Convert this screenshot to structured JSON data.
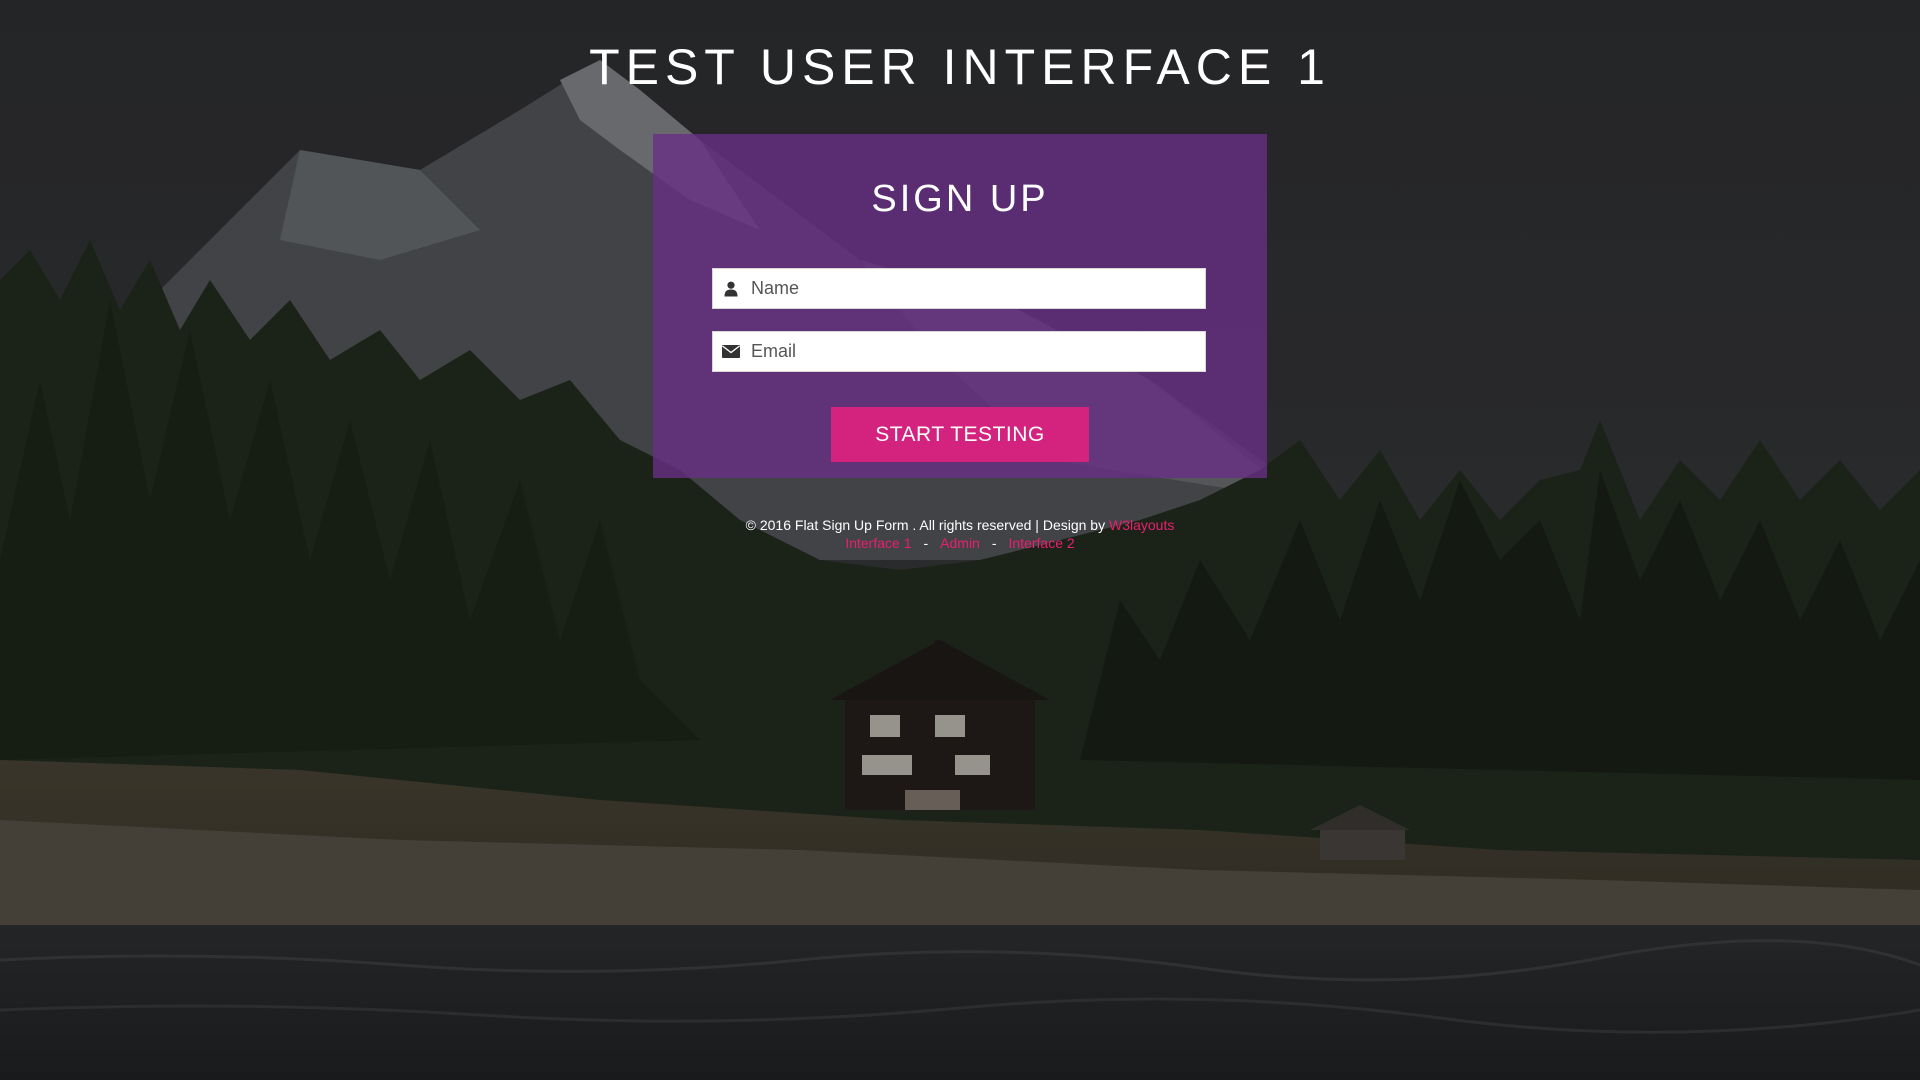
{
  "page": {
    "title": "TEST USER INTERFACE 1"
  },
  "form": {
    "heading": "SIGN UP",
    "name_field": {
      "placeholder": "Name",
      "value": "",
      "icon": "user-icon"
    },
    "email_field": {
      "placeholder": "Email",
      "value": "",
      "icon": "envelope-icon"
    },
    "submit_label": "START TESTING"
  },
  "footer": {
    "copyright": "© 2016 Flat Sign Up Form . All rights reserved | Design by",
    "designer_link": "W3layouts",
    "links": [
      "Interface 1",
      "Admin",
      "Interface 2"
    ],
    "separator": "-"
  },
  "colors": {
    "card": "#682e84",
    "button": "#d4237f",
    "link": "#e8206f",
    "text": "#ffffff"
  }
}
